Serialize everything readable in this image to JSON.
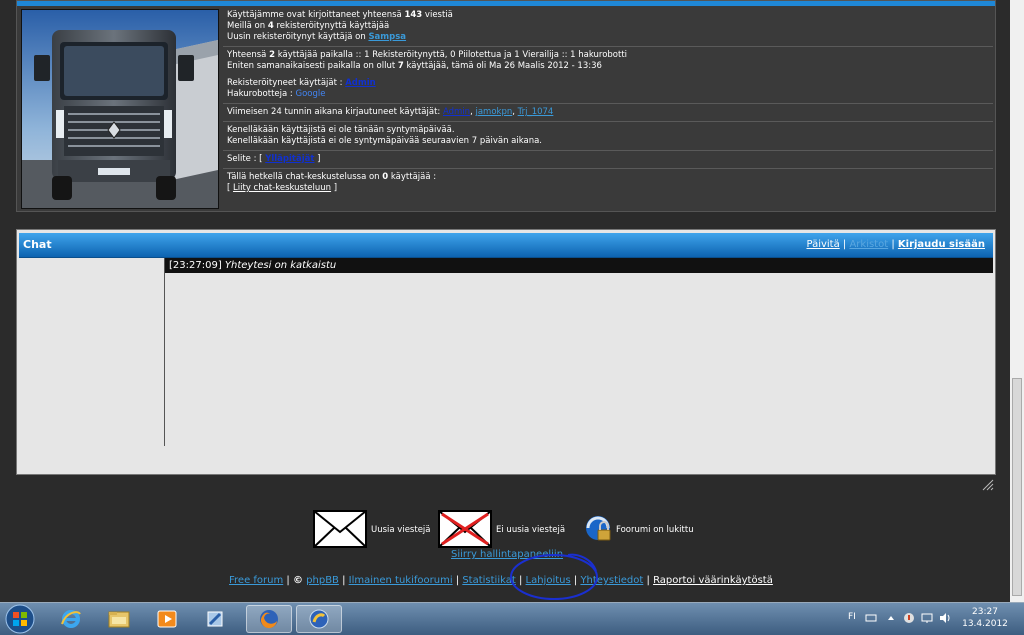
{
  "stats": {
    "posts_pre": "Käyttäjämme ovat kirjoittaneet yhteensä ",
    "posts_count": "143",
    "posts_post": " viestiä",
    "members_pre": "Meillä on ",
    "members_count": "4",
    "members_post": " rekisteröitynyttä käyttäjää",
    "newest_pre": "Uusin rekisteröitynyt käyttäjä on ",
    "newest_user": "Sampsa",
    "online_pre": "Yhteensä ",
    "online_count": "2",
    "online_post": " käyttäjää paikalla :: 1 Rekisteröitynyttä, 0 Piilotettua ja 1 Vierailija :: 1 hakurobotti",
    "record_pre": "Eniten samanaikaisesti paikalla on ollut ",
    "record_count": "7",
    "record_post": " käyttäjää, tämä oli Ma 26 Maalis 2012 - 13:36",
    "registered_label": "Rekisteröityneet käyttäjät : ",
    "registered_user": "Admin",
    "bots_label": "Hakurobotteja : ",
    "bots_name": "Google",
    "last24_label": "Viimeisen 24 tunnin aikana kirjautuneet käyttäjät: ",
    "last24_users": [
      "Admin",
      "jamokpn",
      "Trj_1074"
    ],
    "birthday_today": "Kenelläkään käyttäjistä ei ole tänään syntymäpäivää.",
    "birthday_week": "Kenelläkään käyttäjistä ei ole syntymäpäivää seuraavien 7 päivän aikana.",
    "legend_label": "Selite :  [ ",
    "legend_link": "Ylläpitäjät",
    "legend_end": " ]",
    "chat_count_pre": "Tällä hetkellä chat-keskustelussa on ",
    "chat_count": "0",
    "chat_count_post": " käyttäjää :",
    "join_chat_open": "[ ",
    "join_chat": "Liity chat-keskusteluun",
    "join_chat_close": " ]"
  },
  "chat": {
    "title": "Chat",
    "refresh": "Päivitä",
    "archives": "Arkistot",
    "login": "Kirjaudu sisään",
    "message_time": "[23:27:09]",
    "message_text": "Yhteytesi on katkaistu"
  },
  "legend": {
    "new_posts": "Uusia viestejä",
    "no_new_posts": "Ei uusia viestejä",
    "locked": "Foorumi on lukittu"
  },
  "board_link": "Siirry hallintapaneeliin",
  "footer": {
    "free_forum": "Free forum",
    "copyright": "©",
    "phpbb": "phpBB",
    "free_support": "Ilmainen tukifoorumi",
    "stats": "Statistiikat",
    "donation": "Lahjoitus",
    "contact": "Yhteystiedot",
    "report": "Raportoi väärinkäytöstä"
  },
  "taskbar": {
    "language": "FI",
    "time": "23:27",
    "date": "13.4.2012"
  },
  "colors": {
    "accent_blue": "#1f87d6",
    "link_blue": "#3a9ad9",
    "annotation_circle": "#1a2fd0"
  }
}
